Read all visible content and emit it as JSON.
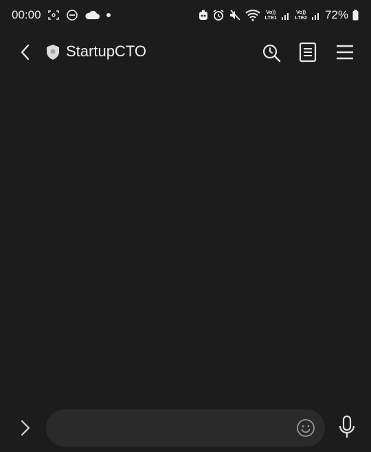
{
  "status_bar": {
    "time": "00:00",
    "lte1_top": "Vo))",
    "lte1_bottom": "LTE1",
    "lte2_top": "Vo))",
    "lte2_bottom": "LTE2",
    "battery": "72%"
  },
  "header": {
    "title": "StartupCTO",
    "icons": [
      "back-arrow-icon",
      "shield-icon",
      "search-icon",
      "notes-icon",
      "menu-icon"
    ]
  },
  "input": {
    "placeholder": "",
    "value": "",
    "icons": [
      "chevron-right-icon",
      "emoji-icon",
      "microphone-icon"
    ]
  },
  "colors": {
    "background": "#1c1c1c",
    "input_background": "#2a2a2a",
    "icon": "#e8e8e8"
  }
}
